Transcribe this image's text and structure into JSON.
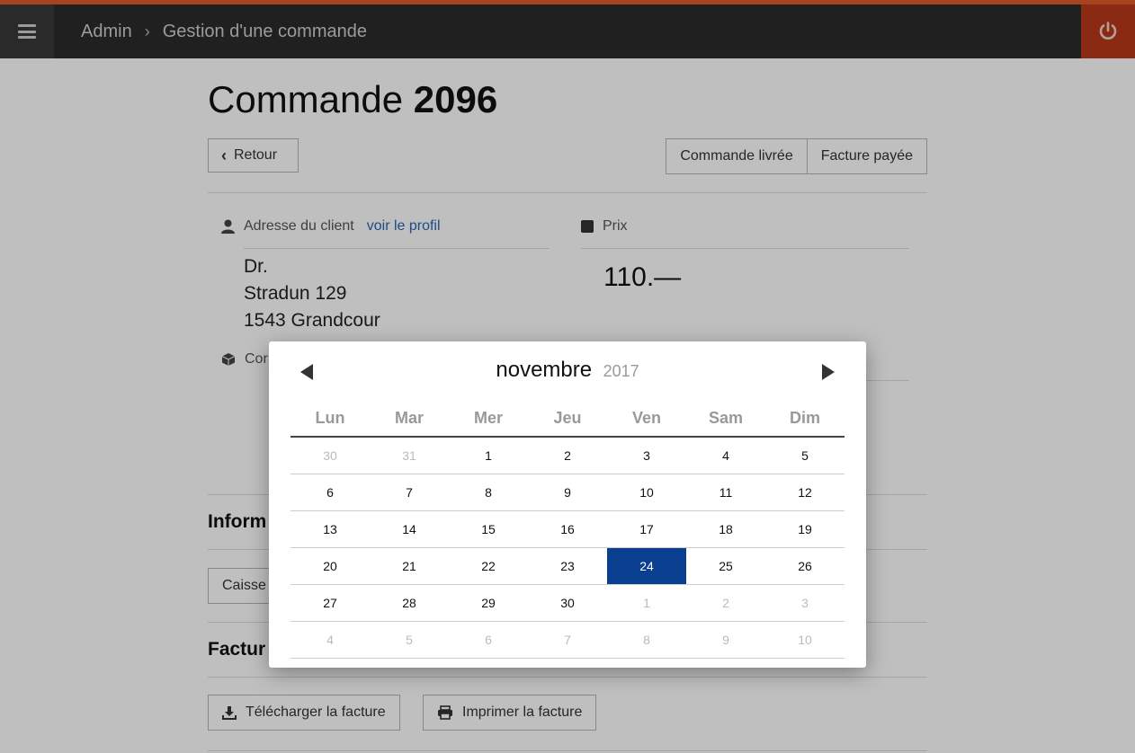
{
  "topbar": {
    "breadcrumb_root": "Admin",
    "breadcrumb_current": "Gestion d'une commande",
    "accent_color": "#e2582a",
    "power_color": "#b83818"
  },
  "order": {
    "title_prefix": "Commande",
    "number": "2096",
    "back_label": "Retour",
    "delivered_label": "Commande livrée",
    "paid_label": "Facture payée"
  },
  "client": {
    "label": "Adresse du client",
    "profile_link": "voir le profil",
    "address": [
      "Dr.",
      "Stradun 129",
      "1543 Grandcour"
    ],
    "second_label_visible": "Cor"
  },
  "price": {
    "label": "Prix",
    "value": "110.—"
  },
  "info_section": {
    "title_visible": "Inform",
    "button_visible": "Caisse"
  },
  "invoice_section": {
    "title_visible": "Factur",
    "download_label": "Télécharger la facture",
    "print_label": "Imprimer la facture"
  },
  "datepicker": {
    "month": "novembre",
    "year": "2017",
    "weekdays": [
      "Lun",
      "Mar",
      "Mer",
      "Jeu",
      "Ven",
      "Sam",
      "Dim"
    ],
    "selected_color": "#0a3e8f",
    "weeks": [
      [
        {
          "d": "30",
          "m": true
        },
        {
          "d": "31",
          "m": true
        },
        {
          "d": "1"
        },
        {
          "d": "2"
        },
        {
          "d": "3"
        },
        {
          "d": "4"
        },
        {
          "d": "5"
        }
      ],
      [
        {
          "d": "6"
        },
        {
          "d": "7"
        },
        {
          "d": "8"
        },
        {
          "d": "9"
        },
        {
          "d": "10"
        },
        {
          "d": "11"
        },
        {
          "d": "12"
        }
      ],
      [
        {
          "d": "13"
        },
        {
          "d": "14"
        },
        {
          "d": "15"
        },
        {
          "d": "16"
        },
        {
          "d": "17"
        },
        {
          "d": "18"
        },
        {
          "d": "19"
        }
      ],
      [
        {
          "d": "20"
        },
        {
          "d": "21"
        },
        {
          "d": "22"
        },
        {
          "d": "23"
        },
        {
          "d": "24",
          "s": true
        },
        {
          "d": "25"
        },
        {
          "d": "26"
        }
      ],
      [
        {
          "d": "27"
        },
        {
          "d": "28"
        },
        {
          "d": "29"
        },
        {
          "d": "30"
        },
        {
          "d": "1",
          "m": true
        },
        {
          "d": "2",
          "m": true
        },
        {
          "d": "3",
          "m": true
        }
      ],
      [
        {
          "d": "4",
          "m": true
        },
        {
          "d": "5",
          "m": true
        },
        {
          "d": "6",
          "m": true
        },
        {
          "d": "7",
          "m": true
        },
        {
          "d": "8",
          "m": true
        },
        {
          "d": "9",
          "m": true
        },
        {
          "d": "10",
          "m": true
        }
      ]
    ]
  }
}
